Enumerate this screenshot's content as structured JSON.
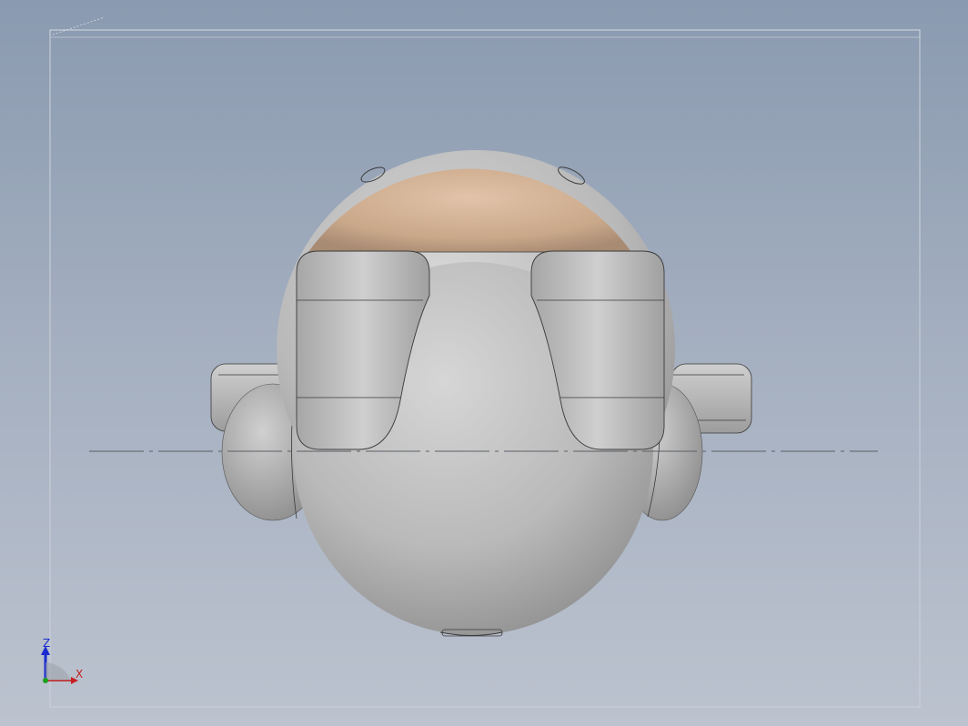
{
  "viewport": {
    "description_free": true,
    "colors": {
      "background_top": "#8a9ab0",
      "background_bottom": "#bcc3cf",
      "model_body": "#c8c8c8",
      "model_head": "#d9b79a",
      "edge": "#3a3a3a",
      "centerline": "#5a5f66"
    }
  },
  "triad": {
    "z_label": "Z",
    "x_label": "X",
    "colors": {
      "z": "#1a2bd0",
      "x": "#c62020",
      "origin": "#1ca01c"
    }
  },
  "corner_note": {
    "text": ""
  }
}
